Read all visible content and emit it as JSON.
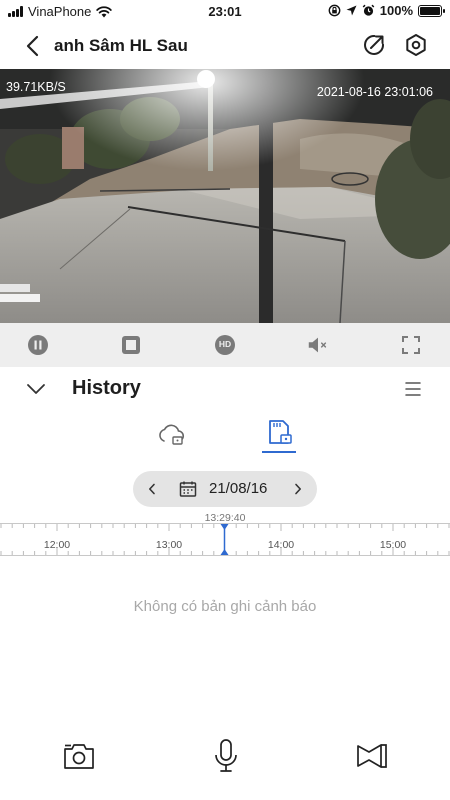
{
  "status_bar": {
    "carrier": "VinaPhone",
    "time": "23:01",
    "battery": "100%",
    "battery_level": 1.0,
    "icons": [
      "signal-icon",
      "wifi-icon",
      "screen-lock-icon",
      "location-icon",
      "alarm-icon",
      "battery-icon"
    ]
  },
  "nav": {
    "title": "anh Sâm HL Sau",
    "icons": [
      "back-icon",
      "share-icon",
      "settings-icon"
    ]
  },
  "video": {
    "speed": "39.71KB/S",
    "timestamp": "2021-08-16 23:01:06"
  },
  "controls": {
    "icons": [
      "pause-icon",
      "stop-icon",
      "hd-icon",
      "mute-icon",
      "fullscreen-icon"
    ],
    "hd_label": "HD"
  },
  "history": {
    "title": "History",
    "icons": [
      "chevron-down-icon",
      "menu-icon"
    ]
  },
  "tabs": {
    "active": "sd-card",
    "icons": [
      "cloud-icon",
      "sd-card-icon"
    ]
  },
  "date": {
    "value": "21/08/16",
    "icons": [
      "chevron-left-icon",
      "calendar-icon",
      "chevron-right-icon"
    ]
  },
  "timeline": {
    "cursor_time": "13:29:40",
    "labels": [
      "12:00",
      "13:00",
      "14:00",
      "15:00"
    ]
  },
  "empty_message": "Không có bản ghi cảnh báo",
  "bottom": {
    "icons": [
      "camera-icon",
      "microphone-icon",
      "video-record-icon"
    ]
  },
  "colors": {
    "accent": "#2f6ad0",
    "control_bar": "#eeeeee",
    "date_pill": "#e4e4e4"
  }
}
